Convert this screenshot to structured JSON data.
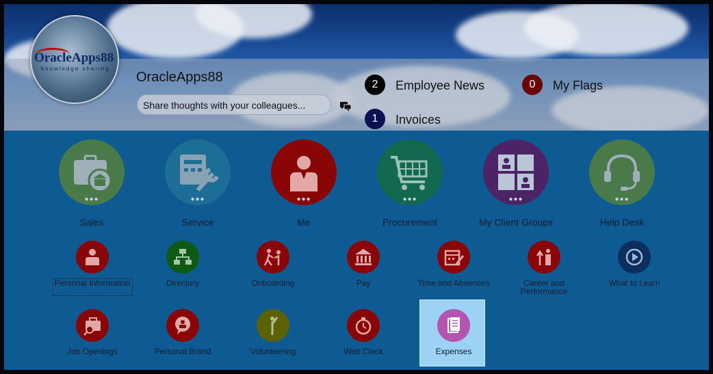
{
  "brand": {
    "logo_text": "OracleApps88",
    "logo_sub": "knowledge sharing"
  },
  "user": {
    "name": "OracleApps88"
  },
  "share": {
    "placeholder": "Share thoughts with your colleagues..."
  },
  "notifications": [
    {
      "count": "2",
      "label": "Employee News",
      "color": "#050505"
    },
    {
      "count": "0",
      "label": "My Flags",
      "color": "#6a0505"
    },
    {
      "count": "1",
      "label": "Invoices",
      "color": "#0b1155"
    }
  ],
  "groups": [
    {
      "label": "Sales",
      "icon": "sales-icon",
      "color": "#4a7a4a"
    },
    {
      "label": "Service",
      "icon": "service-icon",
      "color": "#1d6e96"
    },
    {
      "label": "Me",
      "icon": "person-icon",
      "color": "#8a0505"
    },
    {
      "label": "Procurement",
      "icon": "cart-icon",
      "color": "#12694f"
    },
    {
      "label": "My Client Groups",
      "icon": "client-groups-icon",
      "color": "#4c2466"
    },
    {
      "label": "Help Desk",
      "icon": "headset-icon",
      "color": "#4a7a4a"
    }
  ],
  "apps_row1": [
    {
      "label": "Personal Information",
      "icon": "person-icon",
      "color": "#8a0505"
    },
    {
      "label": "Directory",
      "icon": "org-chart-icon",
      "color": "#0c5a14"
    },
    {
      "label": "Onboarding",
      "icon": "onboarding-icon",
      "color": "#8a0505"
    },
    {
      "label": "Pay",
      "icon": "bank-icon",
      "color": "#8a0505"
    },
    {
      "label": "Time and Absences",
      "icon": "calendar-icon",
      "color": "#8a0505"
    },
    {
      "label": "Career and Performance",
      "icon": "career-icon",
      "color": "#8a0505"
    },
    {
      "label": "What to Learn",
      "icon": "play-icon",
      "color": "#0b2f5e"
    }
  ],
  "apps_row2": [
    {
      "label": "Job Openings",
      "icon": "job-search-icon",
      "color": "#8a0505"
    },
    {
      "label": "Personal Brand",
      "icon": "brand-icon",
      "color": "#8a0505"
    },
    {
      "label": "Volunteering",
      "icon": "volunteer-icon",
      "color": "#5a6205"
    },
    {
      "label": "Web Clock",
      "icon": "clock-icon",
      "color": "#8a0505"
    },
    {
      "label": "Expenses",
      "icon": "document-icon",
      "color": "#b355b0"
    }
  ]
}
